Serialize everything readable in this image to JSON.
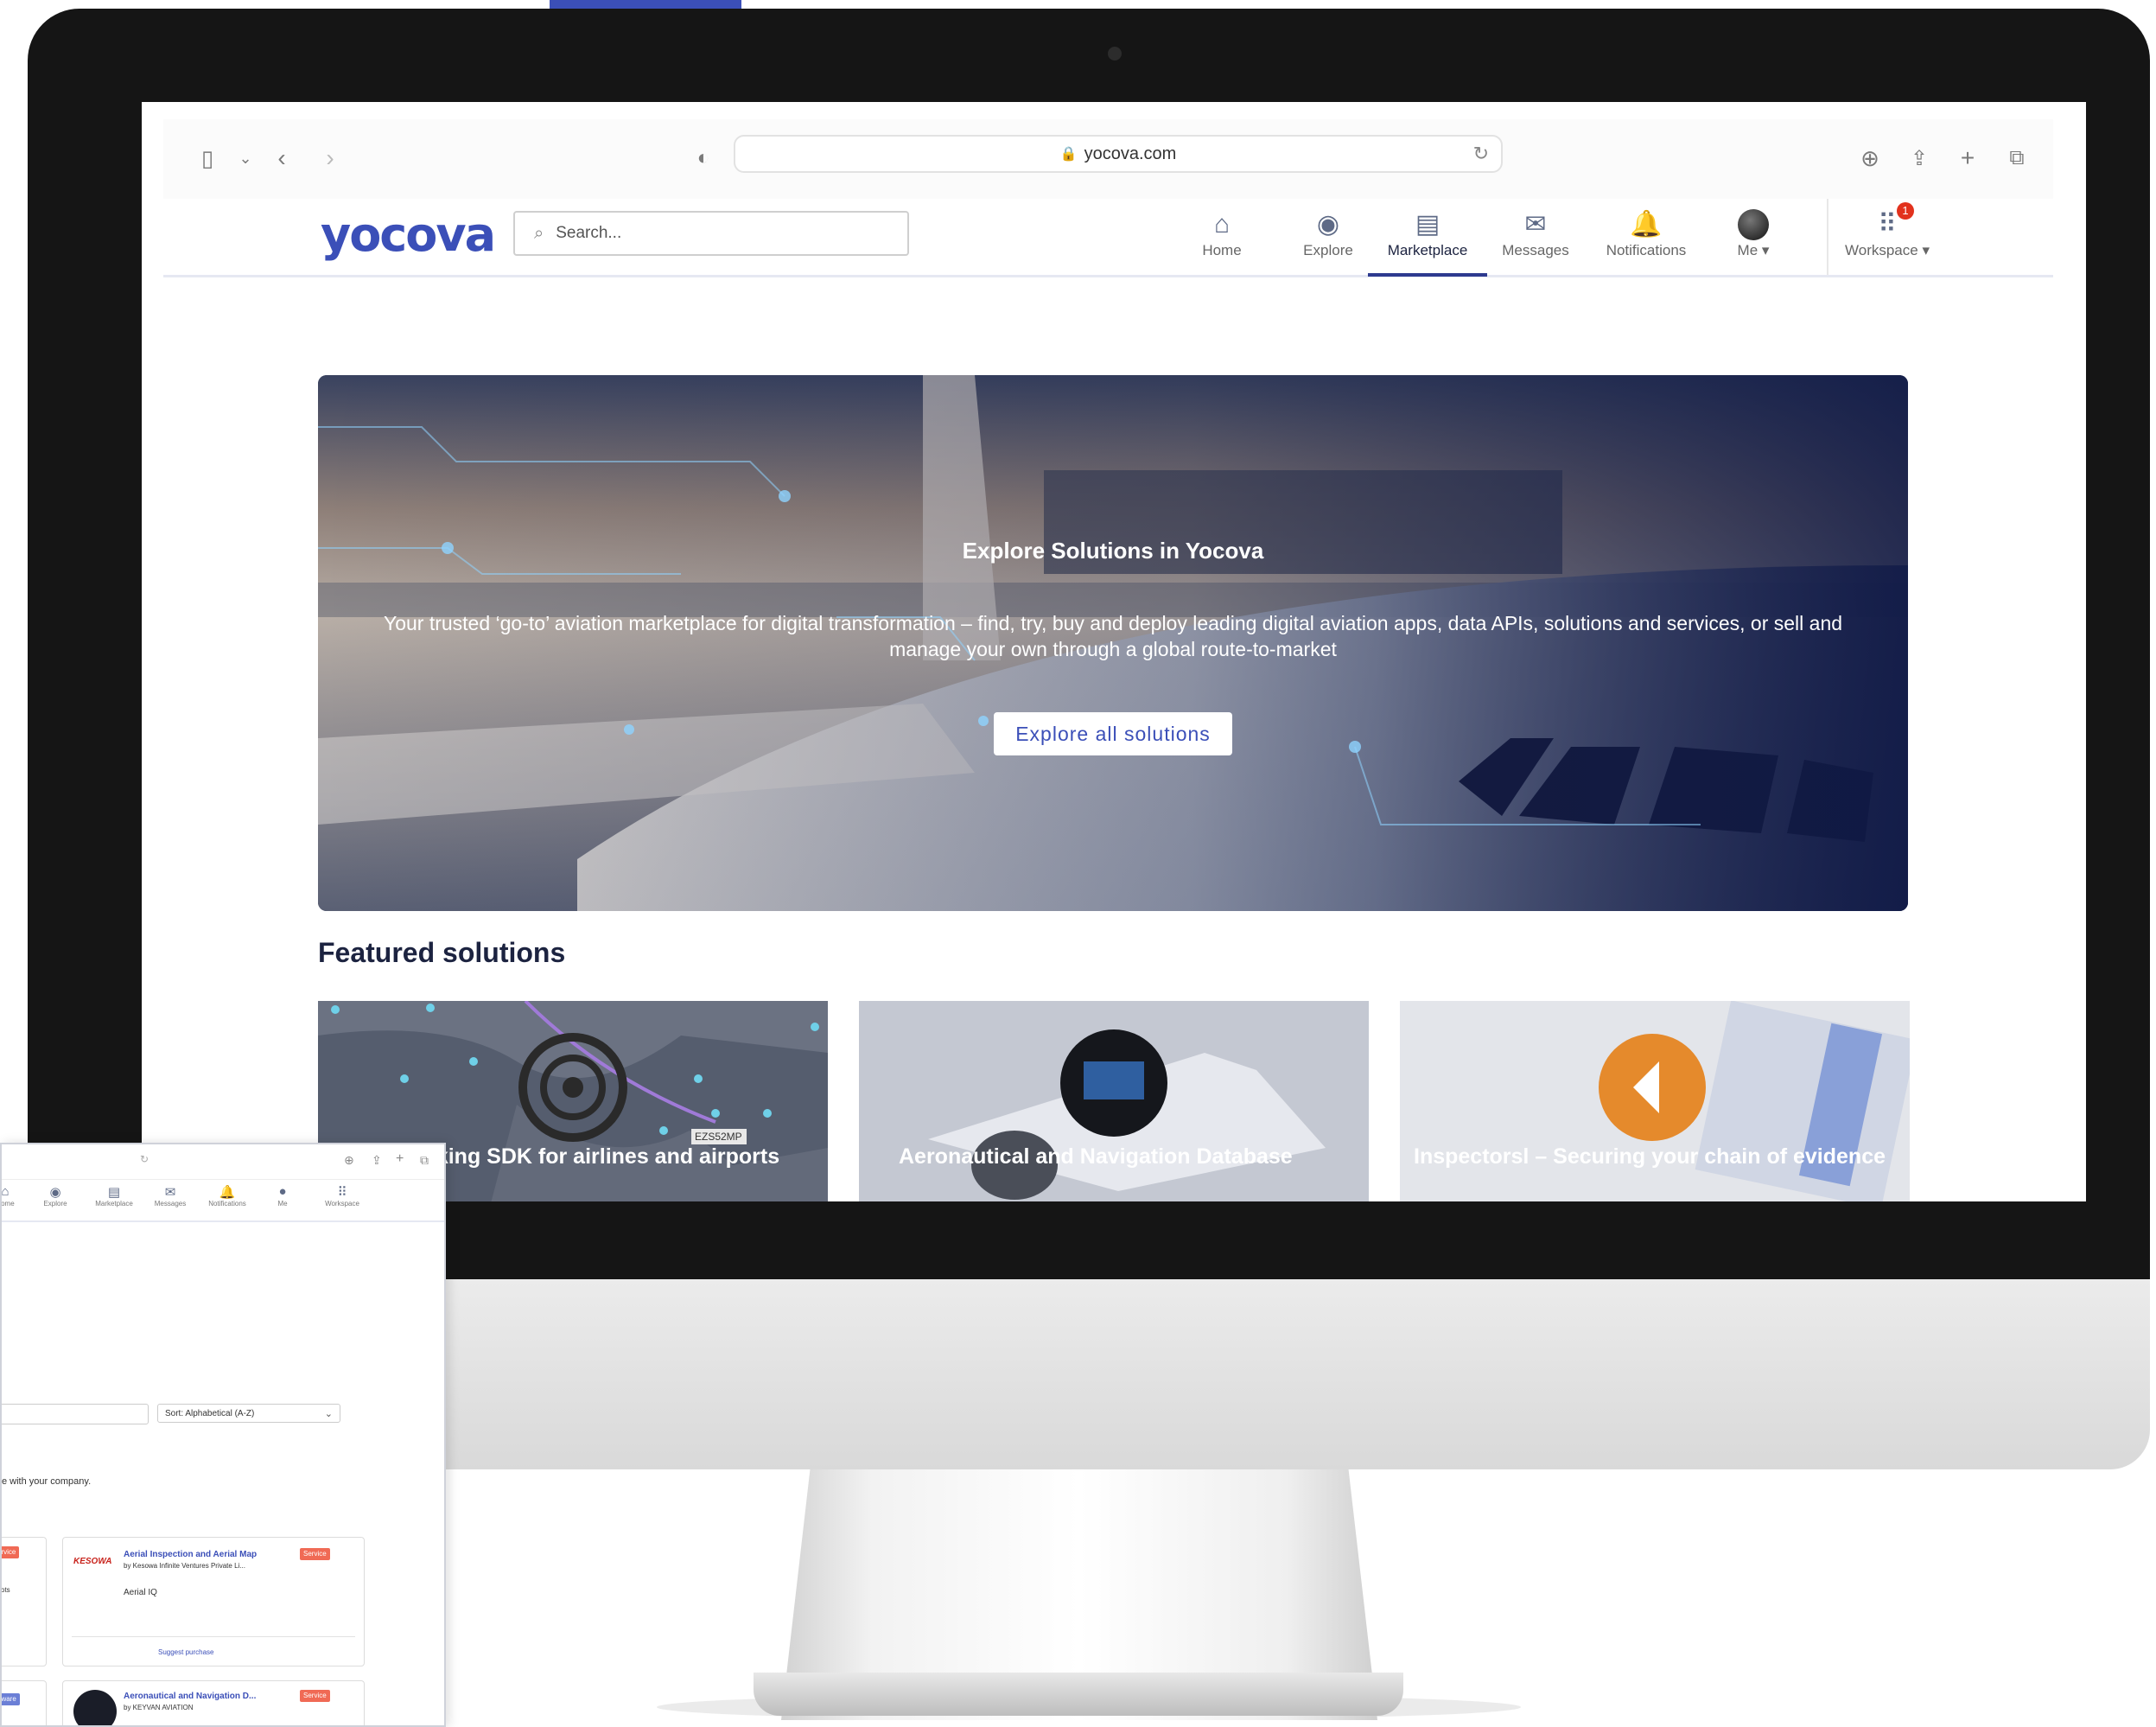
{
  "browser": {
    "url": "yocova.com"
  },
  "site": {
    "logo": "yocova",
    "search_placeholder": "Search...",
    "nav": [
      {
        "label": "Home",
        "icon": "home-icon"
      },
      {
        "label": "Explore",
        "icon": "globe-icon"
      },
      {
        "label": "Marketplace",
        "icon": "store-icon",
        "active": true
      },
      {
        "label": "Messages",
        "icon": "envelope-icon"
      },
      {
        "label": "Notifications",
        "icon": "bell-icon"
      },
      {
        "label": "Me",
        "icon": "avatar"
      },
      {
        "label": "Workspace",
        "icon": "grid-icon",
        "badge": "1"
      }
    ],
    "dropdown_glyph": "▾"
  },
  "hero": {
    "title": "Explore Solutions in Yocova",
    "text": "Your trusted ‘go-to’ aviation marketplace for digital transformation – find, try, buy and deploy leading digital aviation apps, data APIs, solutions and services, or sell and manage your own through a global route-to-market",
    "button": "Explore all solutions"
  },
  "featured": {
    "heading": "Featured solutions",
    "cards": [
      {
        "title": "Flight tracking SDK for airlines and airports",
        "map_label": "EZS52MP"
      },
      {
        "title": "Aeronautical and Navigation Database"
      },
      {
        "title": "Inspectorsl – Securing your chain of evidence"
      }
    ]
  },
  "second_screenshot": {
    "nav": [
      "Home",
      "Explore",
      "Marketplace",
      "Messages",
      "Notifications",
      "Me",
      "Workspace"
    ],
    "sort_select": "Sort: Alphabetical (A-Z)",
    "note": "e with your company.",
    "cards": [
      {
        "title": "Aerial Inspection and Aerial Map",
        "by": "by Kesowa Infinite Ventures Private Li...",
        "tag": "Service",
        "product": "Aerial IQ",
        "link": "Suggest purchase",
        "logo_text": "KESOWA"
      },
      {
        "title": "Aeronautical and Navigation D...",
        "by": "by KEYVAN AVIATION",
        "tag": "Service"
      }
    ],
    "left_tags": [
      "ervice",
      "ftware"
    ],
    "left_fragment": "ots"
  },
  "colors": {
    "brand": "#3b4fb8",
    "nav_text_active": "#1c2340",
    "badge": "#e2321d",
    "service_tag": "#f06a55"
  }
}
